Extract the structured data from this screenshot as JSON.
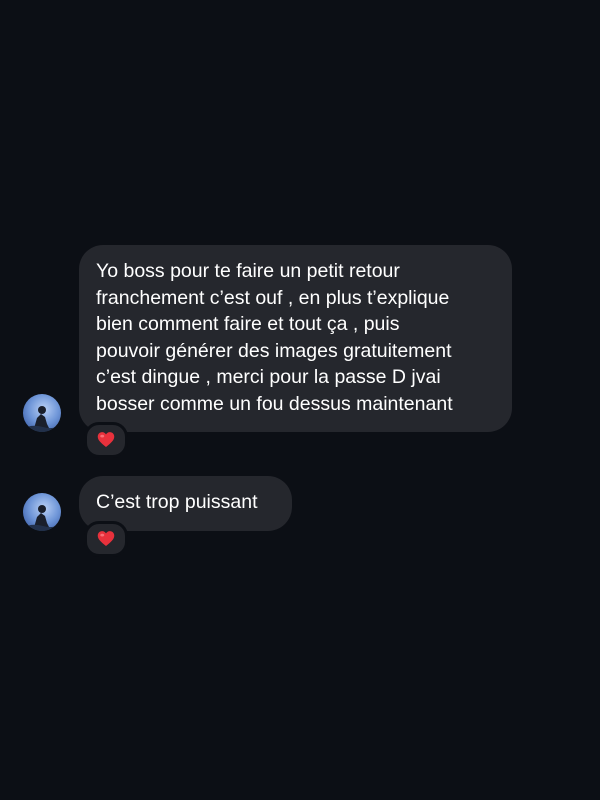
{
  "conversation": {
    "messages": [
      {
        "lines": [
          "Yo boss pour te faire un petit retour",
          "franchement c’est ouf , en plus t’explique",
          "bien comment faire et tout ça , puis",
          "pouvoir générer des images gratuitement",
          "c’est dingue , merci pour la passe D jvai",
          "bosser comme un fou dessus maintenant"
        ],
        "reaction": "heart-icon"
      },
      {
        "lines": [
          "C’est trop puissant"
        ],
        "reaction": "heart-icon"
      }
    ]
  },
  "colors": {
    "background": "#0c0f15",
    "bubble": "#25272d",
    "text": "#ffffff",
    "heart": "#e8313c"
  }
}
